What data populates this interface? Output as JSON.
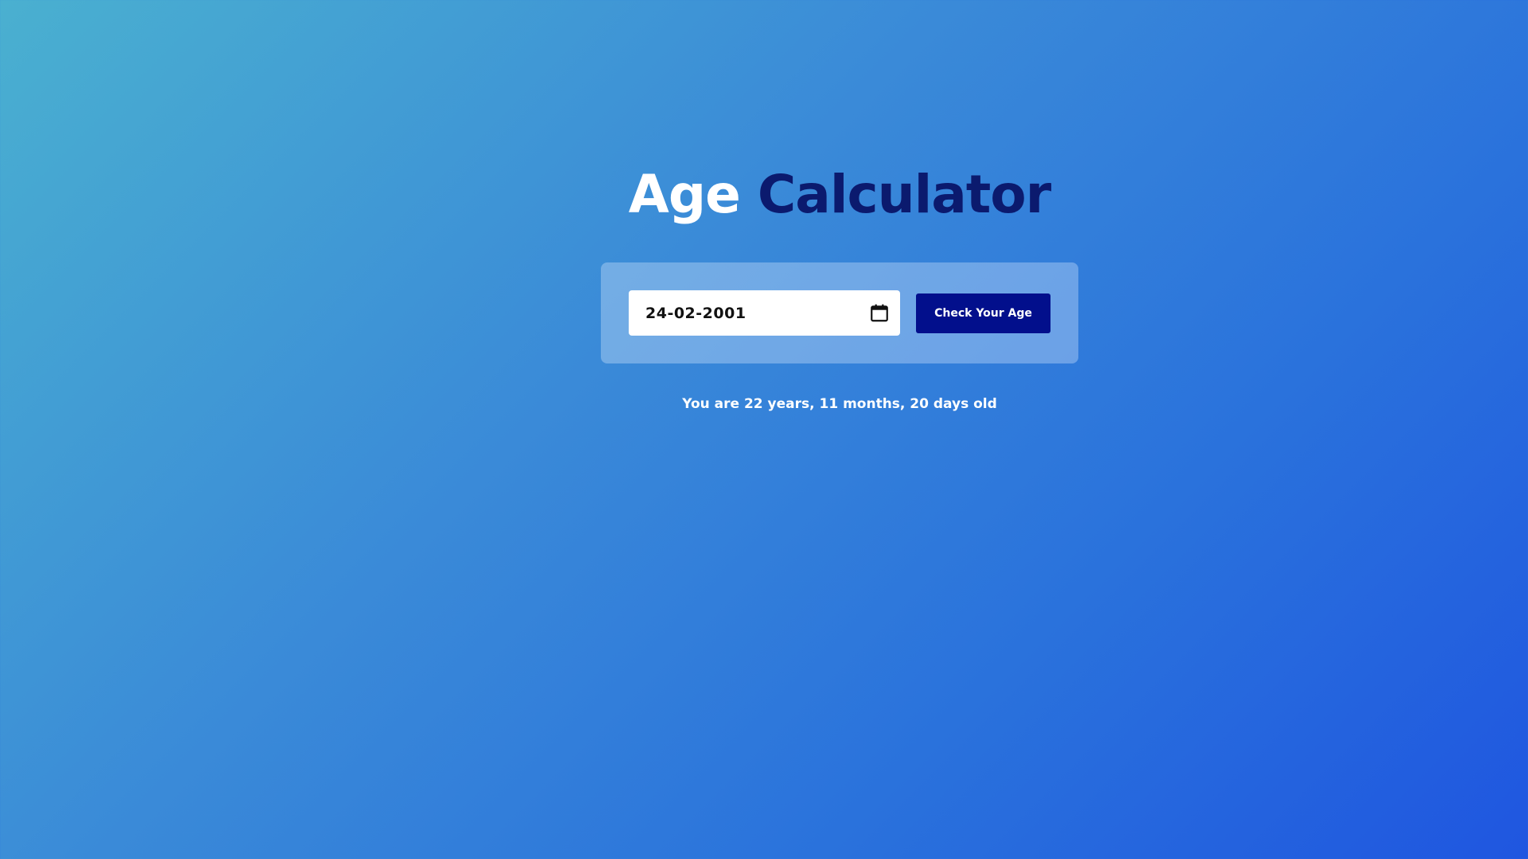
{
  "header": {
    "title_part1": "Age",
    "title_part2": "Calculator"
  },
  "form": {
    "date_value": "24-02-2001",
    "calendar_icon": "calendar-icon",
    "button_label": "Check Your Age"
  },
  "result": {
    "text": "You are 22 years, 11 months, 20 days old"
  },
  "colors": {
    "title_accent": "#0b1a6e",
    "button_bg": "#020f8c"
  }
}
